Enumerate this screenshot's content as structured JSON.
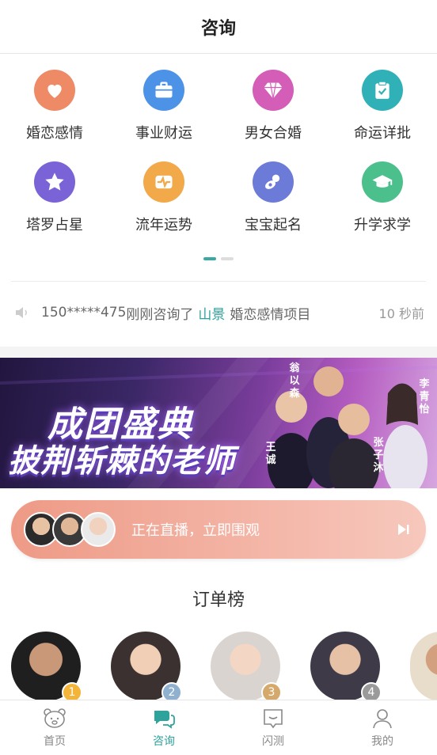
{
  "header": {
    "title": "咨询"
  },
  "categories": [
    {
      "label": "婚恋感情",
      "icon": "heart-icon",
      "color": "#ee8a66"
    },
    {
      "label": "事业财运",
      "icon": "briefcase-icon",
      "color": "#4c93e8"
    },
    {
      "label": "男女合婚",
      "icon": "diamond-icon",
      "color": "#d35db7"
    },
    {
      "label": "命运详批",
      "icon": "clipboard-check-icon",
      "color": "#2fb1b7"
    },
    {
      "label": "塔罗占星",
      "icon": "star-icon",
      "color": "#7a63d6"
    },
    {
      "label": "流年运势",
      "icon": "pulse-icon",
      "color": "#f1a94a"
    },
    {
      "label": "宝宝起名",
      "icon": "pacifier-icon",
      "color": "#6d7bd8"
    },
    {
      "label": "升学求学",
      "icon": "graduation-cap-icon",
      "color": "#4cc08c"
    }
  ],
  "ticker": {
    "user": "150*****475",
    "action": "刚刚咨询了",
    "master": "山景",
    "item": "婚恋感情项目",
    "time": "10 秒前"
  },
  "banner": {
    "line1": "成团盛典",
    "line2": "披荆斩棘的老师",
    "names": [
      "翁以森",
      "李青怡",
      "王诚",
      "张子沐"
    ]
  },
  "live": {
    "text": "正在直播，立即围观"
  },
  "ranking": {
    "title": "订单榜",
    "items": [
      {
        "rank": "1",
        "badge_color": "#f3b43a"
      },
      {
        "rank": "2",
        "badge_color": "#8fb0cf"
      },
      {
        "rank": "3",
        "badge_color": "#d4a96b"
      },
      {
        "rank": "4",
        "badge_color": "#9a9a9a"
      }
    ]
  },
  "tabs": [
    {
      "label": "首页",
      "icon": "bear-face-icon",
      "active": false
    },
    {
      "label": "咨询",
      "icon": "chat-bubbles-icon",
      "active": true
    },
    {
      "label": "闪测",
      "icon": "message-box-icon",
      "active": false
    },
    {
      "label": "我的",
      "icon": "user-icon",
      "active": false
    }
  ],
  "colors": {
    "accent": "#2ea39c",
    "live_gradient_start": "#ee9a86",
    "live_gradient_end": "#f7c8bd"
  }
}
